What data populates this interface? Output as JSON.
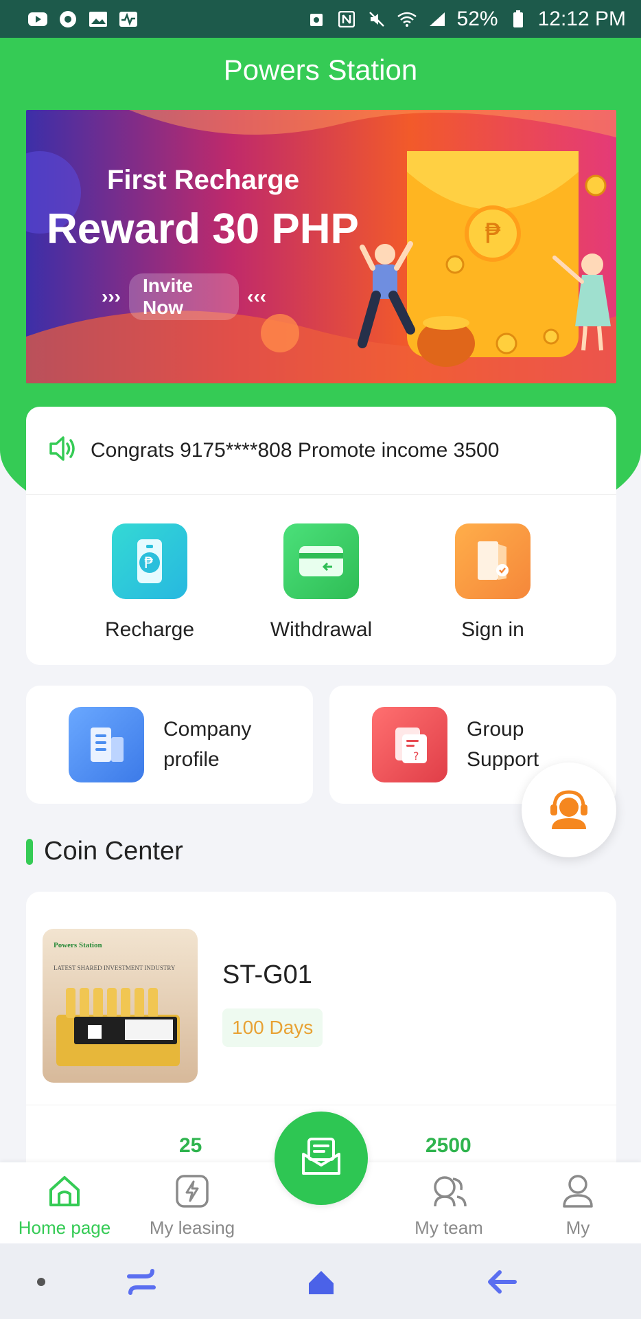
{
  "status_bar": {
    "battery": "52%",
    "time": "12:12 PM",
    "left_icons": [
      "youtube-icon",
      "chrome-icon",
      "gallery-icon",
      "activity-icon"
    ],
    "right_icons": [
      "data-saver-icon",
      "nfc-icon",
      "mute-icon",
      "wifi-icon",
      "signal-icon",
      "battery-icon"
    ]
  },
  "header": {
    "title": "Powers Station"
  },
  "banner": {
    "line1": "First Recharge",
    "line2": "Reward 30 PHP",
    "cta": "Invite Now",
    "arrows_left": "›››",
    "arrows_right": "‹‹‹"
  },
  "notice": {
    "text": "Congrats 9175****808 Promote income 3500"
  },
  "quick_actions": [
    {
      "label": "Recharge",
      "icon": "money-bag-phone-icon",
      "color": "#2fc6d6"
    },
    {
      "label": "Withdrawal",
      "icon": "wallet-card-icon",
      "color": "#34c95a"
    },
    {
      "label": "Sign in",
      "icon": "door-checkin-icon",
      "color": "#f5953a"
    }
  ],
  "features": [
    {
      "label_line1": "Company",
      "label_line2": "profile",
      "icon": "building-icon",
      "color": "#4b8ef0"
    },
    {
      "label_line1": "Group",
      "label_line2": "Support",
      "icon": "document-question-icon",
      "color": "#ee5050"
    }
  ],
  "support_bubble": {
    "icon": "customer-service-icon"
  },
  "coin_center": {
    "title": "Coin Center",
    "product": {
      "name": "ST-G01",
      "days": "100 Days",
      "image_caption_brand": "Powers Station",
      "image_caption_line": "LATEST SHARED   INVESTMENT INDUSTRY"
    },
    "stats": [
      "25",
      "2500"
    ]
  },
  "tab_bar": {
    "tabs": [
      {
        "label": "Home page",
        "icon": "home-icon",
        "active": true
      },
      {
        "label": "My leasing",
        "icon": "lightning-icon",
        "active": false
      },
      {
        "label": "My team",
        "icon": "team-icon",
        "active": false
      },
      {
        "label": "My",
        "icon": "user-icon",
        "active": false
      }
    ],
    "center_icon": "mail-icon"
  },
  "colors": {
    "primary": "#35cb55",
    "status_bar": "#1d5a4b",
    "badge_text": "#e8a234"
  }
}
